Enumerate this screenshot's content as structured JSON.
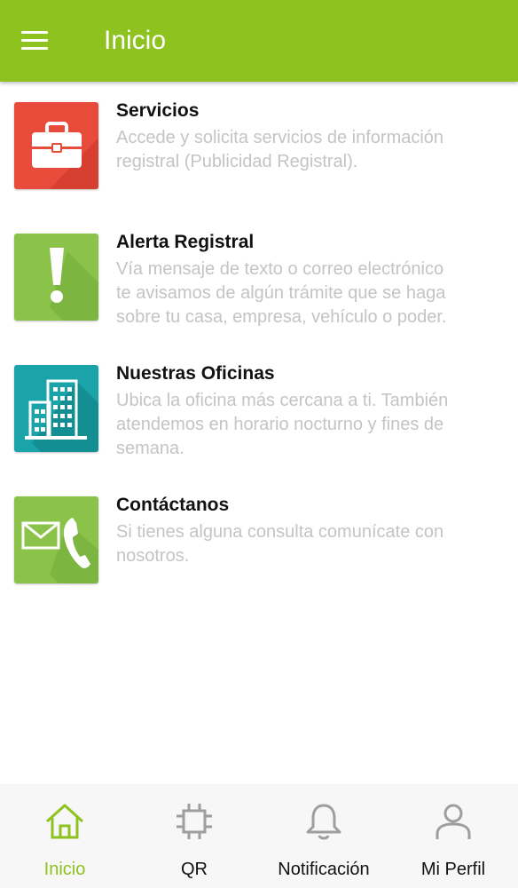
{
  "appbar": {
    "title": "Inicio",
    "menu_icon": "hamburger-menu-icon"
  },
  "colors": {
    "accent": "#8dc21f",
    "tile_red": "#e84b3a",
    "tile_green": "#8bc34a",
    "tile_teal": "#1aa3a8",
    "description_gray": "#c4c4c4",
    "inactive_icon": "#9e9e9e"
  },
  "items": [
    {
      "title": "Servicios",
      "icon": "briefcase-icon",
      "lines": [
        "Accede y solicita servicios de información",
        "registral (Publicidad Registral)."
      ]
    },
    {
      "title": "Alerta Registral",
      "icon": "exclamation-icon",
      "lines": [
        "Vía mensaje de texto o correo electrónico",
        "te avisamos de algún trámite que se haga",
        "sobre tu casa, empresa, vehículo o poder."
      ]
    },
    {
      "title": "Nuestras Oficinas",
      "icon": "office-building-icon",
      "lines": [
        "Ubica la oficina más cercana a ti. También",
        "atendemos en horario nocturno y fines de",
        "semana."
      ]
    },
    {
      "title": "Contáctanos",
      "icon": "envelope-phone-icon",
      "lines": [
        "Si tienes alguna consulta comunícate con",
        "nosotros."
      ]
    }
  ],
  "bottom_nav": [
    {
      "label": "Inicio",
      "icon": "home-icon",
      "active": true
    },
    {
      "label": "QR",
      "icon": "qr-scan-icon",
      "active": false
    },
    {
      "label": "Notificación",
      "icon": "bell-icon",
      "active": false
    },
    {
      "label": "Mi Perfil",
      "icon": "user-icon",
      "active": false
    }
  ]
}
